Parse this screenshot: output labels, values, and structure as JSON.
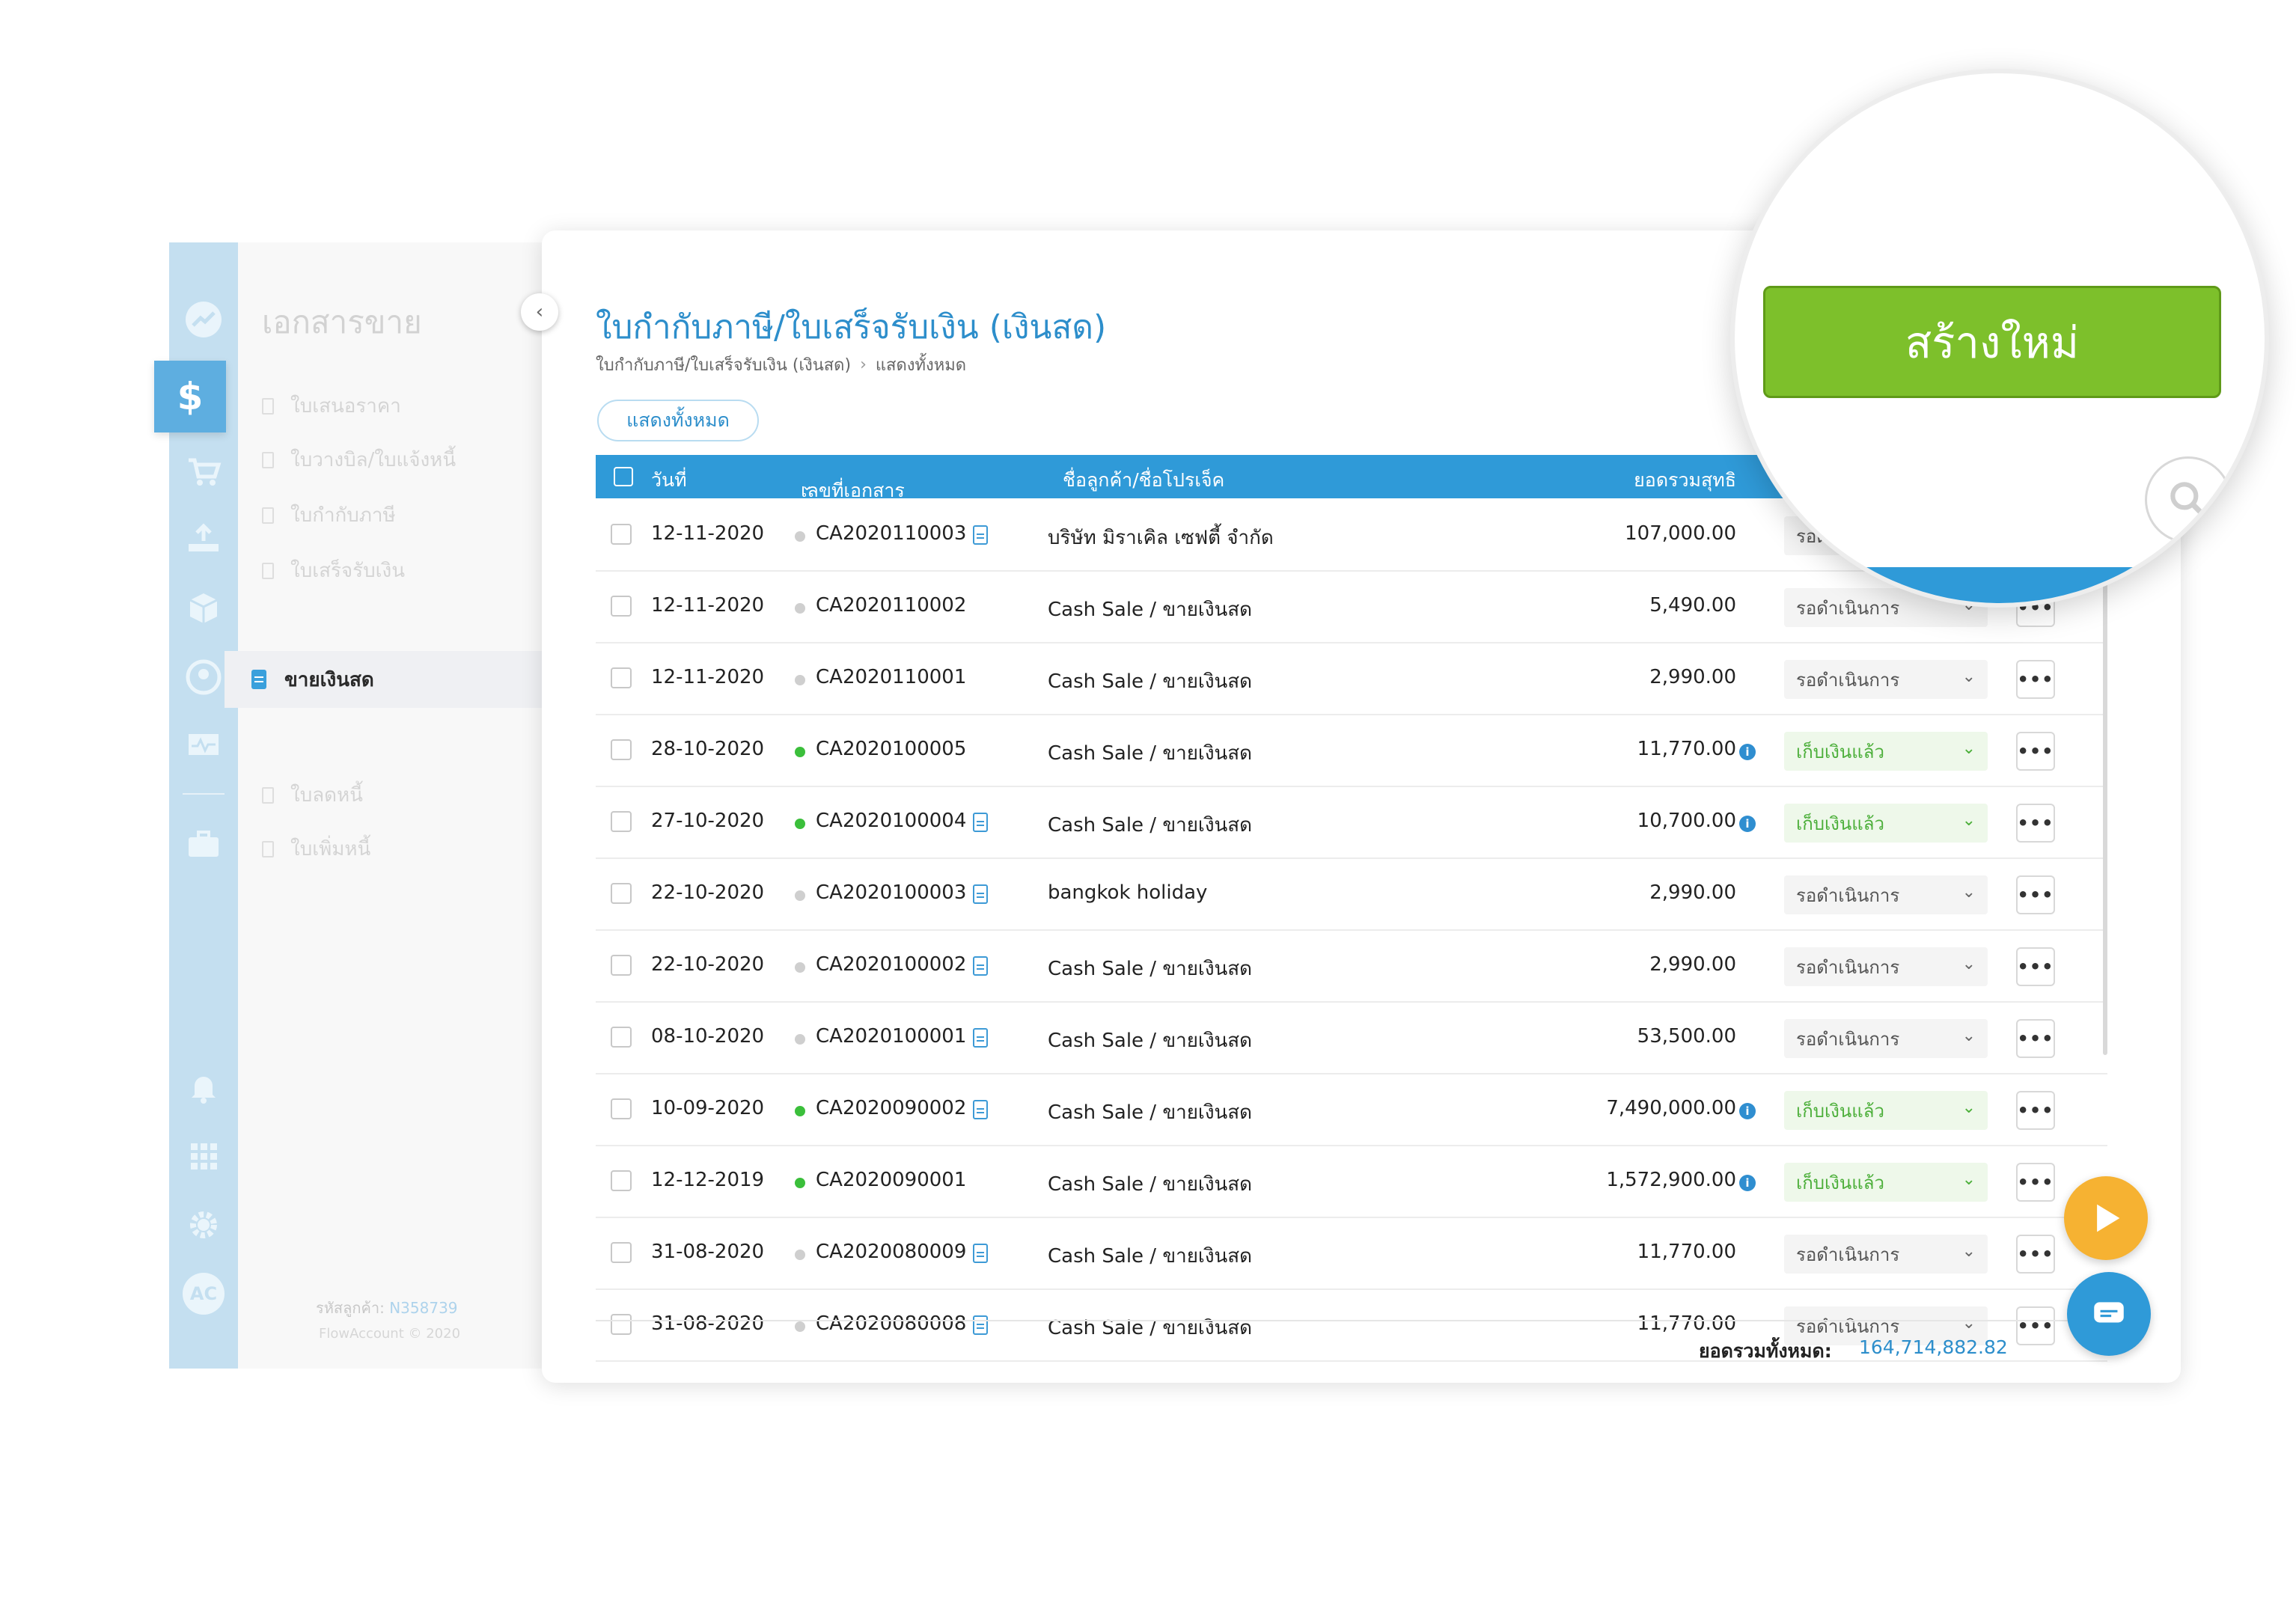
{
  "sidebar": {
    "section_title": "เอกสารขาย",
    "items": [
      {
        "label": "ใบเสนอราคา"
      },
      {
        "label": "ใบวางบิล/ใบแจ้งหนี้"
      },
      {
        "label": "ใบกำกับภาษี"
      },
      {
        "label": "ใบเสร็จรับเงิน"
      }
    ],
    "active_item": "ขายเงินสด",
    "extra_items": [
      {
        "label": "ใบลดหนี้"
      },
      {
        "label": "ใบเพิ่มหนี้"
      }
    ],
    "customer_label": "รหัสลูกค้า:",
    "customer_code": "N358739",
    "copyright": "FlowAccount © 2020",
    "rail_active_symbol": "$",
    "rail_avatar_text": "AC"
  },
  "header": {
    "title": "ใบกำกับภาษี/ใบเสร็จรับเงิน (เงินสด)",
    "breadcrumb": [
      "ใบกำกับภาษี/ใบเสร็จรับเงิน (เงินสด)",
      "แสดงทั้งหมด"
    ],
    "filter_label": "แสดงทั้งหมด"
  },
  "table": {
    "columns": {
      "date": "วันที่",
      "doc_no": "เลขที่เอกสาร",
      "customer": "ชื่อลูกค้า/ชื่อโปรเจ็ค",
      "amount": "ยอดรวมสุทธิ"
    },
    "rows": [
      {
        "date": "12-11-2020",
        "doc": "CA2020110003",
        "customer": "บริษัท มิราเคิล เซฟตี้ จำกัด",
        "amount": "107,000.00",
        "status": "รอดำเนินการ",
        "done": false,
        "file": true,
        "info": false
      },
      {
        "date": "12-11-2020",
        "doc": "CA2020110002",
        "customer": "Cash Sale / ขายเงินสด",
        "amount": "5,490.00",
        "status": "รอดำเนินการ",
        "done": false,
        "file": false,
        "info": false
      },
      {
        "date": "12-11-2020",
        "doc": "CA2020110001",
        "customer": "Cash Sale / ขายเงินสด",
        "amount": "2,990.00",
        "status": "รอดำเนินการ",
        "done": false,
        "file": false,
        "info": false
      },
      {
        "date": "28-10-2020",
        "doc": "CA2020100005",
        "customer": "Cash Sale / ขายเงินสด",
        "amount": "11,770.00",
        "status": "เก็บเงินแล้ว",
        "done": true,
        "file": false,
        "info": true
      },
      {
        "date": "27-10-2020",
        "doc": "CA2020100004",
        "customer": "Cash Sale / ขายเงินสด",
        "amount": "10,700.00",
        "status": "เก็บเงินแล้ว",
        "done": true,
        "file": true,
        "info": true
      },
      {
        "date": "22-10-2020",
        "doc": "CA2020100003",
        "customer": "bangkok holiday",
        "amount": "2,990.00",
        "status": "รอดำเนินการ",
        "done": false,
        "file": true,
        "info": false
      },
      {
        "date": "22-10-2020",
        "doc": "CA2020100002",
        "customer": "Cash Sale / ขายเงินสด",
        "amount": "2,990.00",
        "status": "รอดำเนินการ",
        "done": false,
        "file": true,
        "info": false
      },
      {
        "date": "08-10-2020",
        "doc": "CA2020100001",
        "customer": "Cash Sale / ขายเงินสด",
        "amount": "53,500.00",
        "status": "รอดำเนินการ",
        "done": false,
        "file": true,
        "info": false
      },
      {
        "date": "10-09-2020",
        "doc": "CA2020090002",
        "customer": "Cash Sale / ขายเงินสด",
        "amount": "7,490,000.00",
        "status": "เก็บเงินแล้ว",
        "done": true,
        "file": true,
        "info": true
      },
      {
        "date": "12-12-2019",
        "doc": "CA2020090001",
        "customer": "Cash Sale / ขายเงินสด",
        "amount": "1,572,900.00",
        "status": "เก็บเงินแล้ว",
        "done": true,
        "file": false,
        "info": true
      },
      {
        "date": "31-08-2020",
        "doc": "CA2020080009",
        "customer": "Cash Sale / ขายเงินสด",
        "amount": "11,770.00",
        "status": "รอดำเนินการ",
        "done": false,
        "file": true,
        "info": false
      },
      {
        "date": "31-08-2020",
        "doc": "CA2020080008",
        "customer": "Cash Sale / ขายเงินสด",
        "amount": "11,770.00",
        "status": "รอดำเนินการ",
        "done": false,
        "file": true,
        "info": false
      }
    ],
    "more_label": "•••",
    "info_symbol": "i",
    "status_chevron": "⌄"
  },
  "footer": {
    "total_label": "ยอดรวมทั้งหมด:",
    "total_value": "164,714,882.82"
  },
  "magnifier": {
    "create_label": "สร้างใหม่"
  }
}
